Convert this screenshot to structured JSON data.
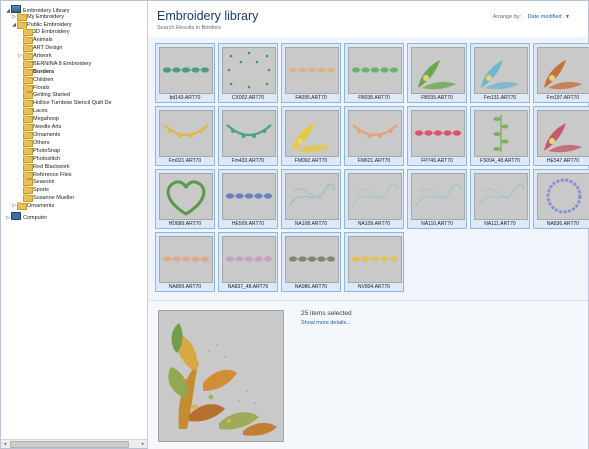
{
  "tree": {
    "nodes": [
      {
        "label": "Embroidery Library",
        "icon": "library-icon",
        "toggle": "expanded"
      },
      {
        "label": "My Embroidery",
        "icon": "folder-icon",
        "toggle": "collapsed"
      },
      {
        "label": "Public Embroidery",
        "icon": "folder-icon",
        "toggle": "expanded"
      },
      {
        "label": "3D Embroidery",
        "icon": "folder-icon",
        "toggle": "none"
      },
      {
        "label": "Animals",
        "icon": "folder-icon",
        "toggle": "none"
      },
      {
        "label": "ART Design",
        "icon": "folder-icon",
        "toggle": "none"
      },
      {
        "label": "Artwork",
        "icon": "folder-icon",
        "toggle": "collapsed"
      },
      {
        "label": "BERNINA 8 Embroidery",
        "icon": "folder-icon",
        "toggle": "none"
      },
      {
        "label": "Borders",
        "icon": "folder-icon",
        "toggle": "none",
        "selected": true
      },
      {
        "label": "Children",
        "icon": "folder-icon",
        "toggle": "none"
      },
      {
        "label": "Florals",
        "icon": "folder-icon",
        "toggle": "none"
      },
      {
        "label": "Getting Started",
        "icon": "folder-icon",
        "toggle": "none"
      },
      {
        "label": "Hollice Turnbow Stencil Quilt De",
        "icon": "folder-icon",
        "toggle": "none"
      },
      {
        "label": "Laces",
        "icon": "folder-icon",
        "toggle": "none"
      },
      {
        "label": "Megahoop",
        "icon": "folder-icon",
        "toggle": "none"
      },
      {
        "label": "Needle Arts",
        "icon": "folder-icon",
        "toggle": "none"
      },
      {
        "label": "Ornaments",
        "icon": "folder-icon",
        "toggle": "none"
      },
      {
        "label": "Others",
        "icon": "folder-icon",
        "toggle": "none"
      },
      {
        "label": "PhotoSnap",
        "icon": "folder-icon",
        "toggle": "none"
      },
      {
        "label": "Photostitch",
        "icon": "folder-icon",
        "toggle": "none"
      },
      {
        "label": "Red Blackwork",
        "icon": "folder-icon",
        "toggle": "none"
      },
      {
        "label": "Reference Files",
        "icon": "folder-icon",
        "toggle": "none"
      },
      {
        "label": "Seasons",
        "icon": "folder-icon",
        "toggle": "none"
      },
      {
        "label": "Sports",
        "icon": "folder-icon",
        "toggle": "none"
      },
      {
        "label": "Susanne Mueller",
        "icon": "folder-icon",
        "toggle": "none"
      },
      {
        "label": "Ornaments",
        "icon": "folder-icon",
        "toggle": "collapsed"
      },
      {
        "label": "Computer",
        "icon": "computer-icon",
        "toggle": "collapsed"
      }
    ]
  },
  "header": {
    "title": "Embroidery library",
    "subtitle": "Search Results in Borders",
    "arrange_label": "Arrange by:",
    "arrange_value": "Date modified"
  },
  "files": [
    {
      "name": "bd143.ART70",
      "motif": "band",
      "color": "#4a9a8a"
    },
    {
      "name": "CX002.ART70",
      "motif": "dots",
      "color": "#3f8f86"
    },
    {
      "name": "FA095.ART70",
      "motif": "band",
      "color": "#d7b58a"
    },
    {
      "name": "FB038.ART70",
      "motif": "band",
      "color": "#6bb36b"
    },
    {
      "name": "FB039.ART70",
      "motif": "corner",
      "color": "#6aa84f"
    },
    {
      "name": "Fm131.ART70",
      "motif": "corner",
      "color": "#6fb6c8"
    },
    {
      "name": "Fm197.ART70",
      "motif": "corner",
      "color": "#c9713a"
    },
    {
      "name": "Fm021.ART70",
      "motif": "swag",
      "color": "#e0b84b"
    },
    {
      "name": "Fm433.ART70",
      "motif": "swag",
      "color": "#4aa28a"
    },
    {
      "name": "FM092.ART70",
      "motif": "corner",
      "color": "#e6c93a"
    },
    {
      "name": "FM621.ART70",
      "motif": "swag",
      "color": "#e3a37a"
    },
    {
      "name": "FP749.ART70",
      "motif": "band",
      "color": "#d9536a"
    },
    {
      "name": "FS094_48.ART70",
      "motif": "vertical",
      "color": "#7cb15a"
    },
    {
      "name": "HE547.ART70",
      "motif": "corner",
      "color": "#c75a6a"
    },
    {
      "name": "HD689.ART70",
      "motif": "heart",
      "color": "#5a9a4a"
    },
    {
      "name": "HE509.ART70",
      "motif": "band",
      "color": "#6a7fc0"
    },
    {
      "name": "NA108.ART70",
      "motif": "swirl",
      "color": "#9fc2c8"
    },
    {
      "name": "NA109.ART70",
      "motif": "swirl",
      "color": "#a9c8cc"
    },
    {
      "name": "NA110.ART70",
      "motif": "swirl",
      "color": "#a6c6cc"
    },
    {
      "name": "NA111.ART70",
      "motif": "swirl",
      "color": "#a8c4cc"
    },
    {
      "name": "NA836.ART70",
      "motif": "ring",
      "color": "#8a8fd0"
    },
    {
      "name": "NA869.ART70",
      "motif": "band",
      "color": "#e2a98a"
    },
    {
      "name": "NA837_48.ART70",
      "motif": "band",
      "color": "#c7a0c8"
    },
    {
      "name": "NA986.ART70",
      "motif": "band",
      "color": "#7a8a6a"
    },
    {
      "name": "NV804.ART70",
      "motif": "band",
      "color": "#e2c15a"
    }
  ],
  "details": {
    "count_text": "25 items selected",
    "more_link": "Show more details..."
  },
  "colors": {
    "title": "#1e3a6a",
    "link": "#1f5fae",
    "tile_selected_bg": "#dbe9fa",
    "tile_selected_border": "#8fb6e2"
  }
}
